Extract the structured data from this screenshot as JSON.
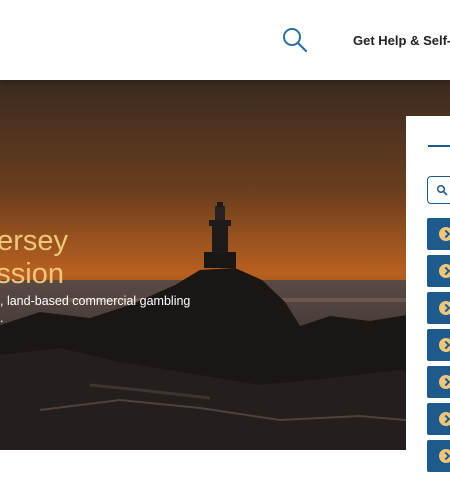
{
  "header": {
    "help_link": "Get Help & Self-E"
  },
  "hero": {
    "title_line1": "ersey",
    "title_line2": "ssion",
    "subtitle_line1": ", land-based commercial gambling",
    "subtitle_line2": "."
  },
  "panel": {
    "search_placeholder": "",
    "link_count": 7
  },
  "colors": {
    "brand_blue": "#1e5a8c",
    "accent_gold": "#f0c77a",
    "sunset_orange": "#c8641e"
  },
  "icons": {
    "header_search": "search-icon",
    "panel_search": "search-icon",
    "link_arrow": "chevron-right-icon"
  }
}
